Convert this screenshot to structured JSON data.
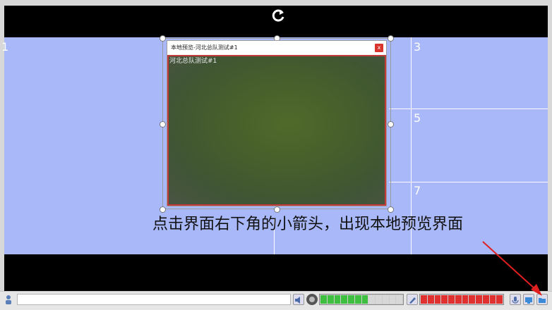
{
  "grid": {
    "cell_numbers": [
      "1",
      "3",
      "5",
      "7"
    ]
  },
  "preview_window": {
    "title": "本地预览-河北总队测试#1",
    "close_label": "x",
    "osd_text": "河北总队测试#1"
  },
  "caption": "点击界面右下角的小箭头，出现本地预览界面",
  "statusbar": {
    "volume_level": 0.55,
    "mic_level": 1.0
  },
  "colors": {
    "grid_bg": "#a9b8f9",
    "video_border": "#c23a3a",
    "volume_meter": "#3fbf3f",
    "mic_meter": "#e03030",
    "arrow": "#e02020"
  },
  "icons": [
    "rotate-icon",
    "close-icon",
    "person-icon",
    "speaker-icon",
    "record-icon",
    "pen-icon",
    "microphone-icon",
    "monitor-icon",
    "folder-icon",
    "arrow-icon"
  ]
}
